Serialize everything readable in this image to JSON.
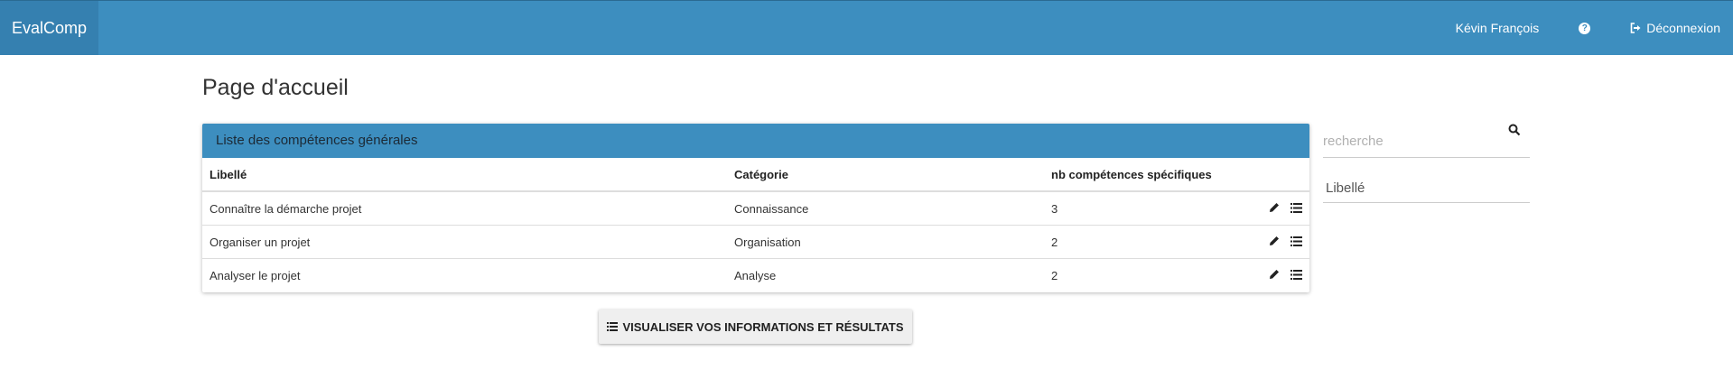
{
  "navbar": {
    "brand": "EvalComp",
    "user_name": "Kévin François",
    "help_icon": "question-circle-icon",
    "logout_label": "Déconnexion",
    "logout_icon": "sign-out-icon"
  },
  "page": {
    "title": "Page d'accueil"
  },
  "panel": {
    "heading": "Liste des compétences générales",
    "columns": [
      "Libellé",
      "Catégorie",
      "nb compétences spécifiques"
    ],
    "rows": [
      {
        "libelle": "Connaître la démarche projet",
        "categorie": "Connaissance",
        "nb": "3"
      },
      {
        "libelle": "Organiser un projet",
        "categorie": "Organisation",
        "nb": "2"
      },
      {
        "libelle": "Analyser le projet",
        "categorie": "Analyse",
        "nb": "2"
      }
    ],
    "row_actions": [
      "pencil-icon",
      "list-icon"
    ]
  },
  "visualize_button": {
    "label": "VISUALISER VOS INFORMATIONS ET RÉSULTATS",
    "icon": "list-icon"
  },
  "sidebar": {
    "search_placeholder": "recherche",
    "search_value": "",
    "filter_label": "Libellé"
  },
  "colors": {
    "primary": "#3d8ebf",
    "brand_bg": "#3580b0"
  }
}
